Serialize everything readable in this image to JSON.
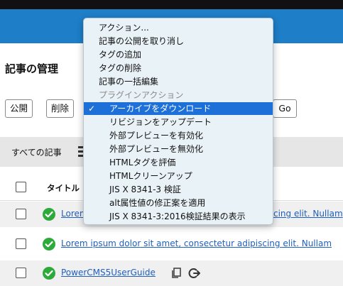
{
  "page": {
    "title": "記事の管理"
  },
  "toolbar": {
    "publish_label": "公開",
    "delete_label": "削除",
    "go_label": "Go"
  },
  "filter": {
    "label": "すべての記事"
  },
  "table": {
    "title_header": "タイトル",
    "rows": [
      {
        "title": "Lorem",
        "title_right": "cing elit. Nullam"
      },
      {
        "title": "Lorem ipsum dolor sit amet, consectetur adipiscing elit. Nullam"
      },
      {
        "title": "PowerCMS5UserGuide"
      }
    ]
  },
  "menu": {
    "items": [
      {
        "label": "アクション..."
      },
      {
        "label": "記事の公開を取り消し"
      },
      {
        "label": "タグの追加"
      },
      {
        "label": "タグの削除"
      },
      {
        "label": "記事の一括編集"
      },
      {
        "label": "プラグインアクション"
      },
      {
        "label": "アーカイブをダウンロード"
      },
      {
        "label": "リビジョンをアップデート"
      },
      {
        "label": "外部プレビューを有効化"
      },
      {
        "label": "外部プレビューを無効化"
      },
      {
        "label": "HTMLタグを評価"
      },
      {
        "label": "HTMLクリーンアップ"
      },
      {
        "label": "JIS X 8341-3 検証"
      },
      {
        "label": "alt属性値の修正案を適用"
      },
      {
        "label": "JIS X 8341-3:2016検証結果の表示"
      }
    ],
    "selected_check": "✓"
  },
  "colors": {
    "header": "#1e7ec8",
    "menu_selected": "#1d70d8",
    "status_published": "#2eaa3a",
    "link": "#1f5fbf"
  }
}
